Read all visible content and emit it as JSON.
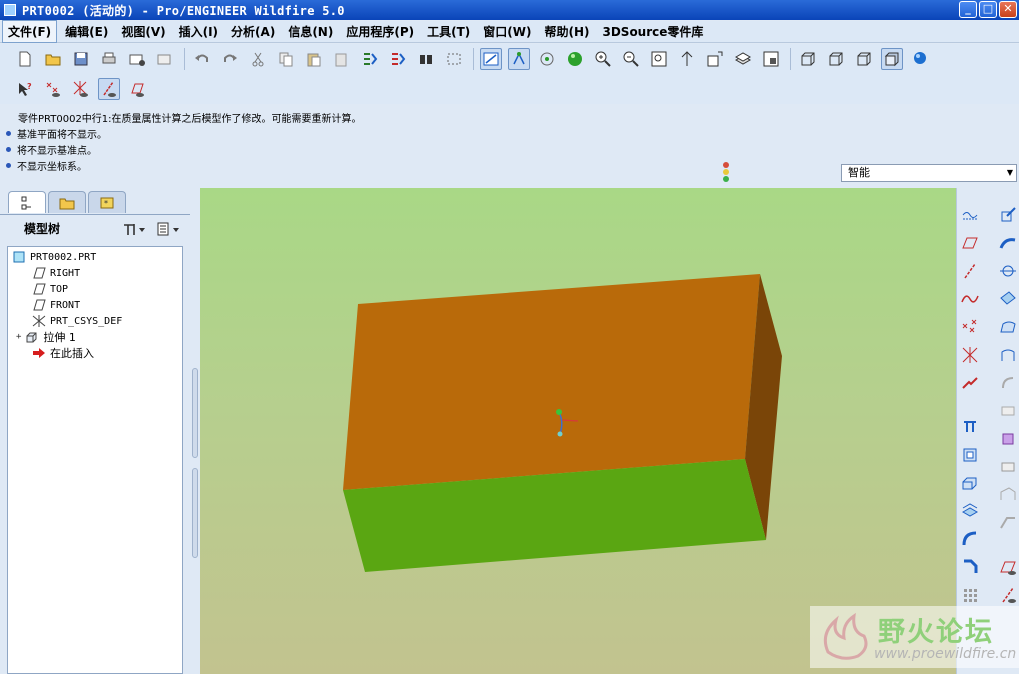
{
  "window": {
    "title": "PRT0002 (活动的) - Pro/ENGINEER Wildfire 5.0",
    "minimize": "_",
    "maximize": "□",
    "close": "✕"
  },
  "menu": [
    {
      "label": "文件(F)",
      "active": true
    },
    {
      "label": "编辑(E)"
    },
    {
      "label": "视图(V)"
    },
    {
      "label": "插入(I)"
    },
    {
      "label": "分析(A)"
    },
    {
      "label": "信息(N)"
    },
    {
      "label": "应用程序(P)"
    },
    {
      "label": "工具(T)"
    },
    {
      "label": "窗口(W)"
    },
    {
      "label": "帮助(H)"
    },
    {
      "label": "3DSource零件库"
    }
  ],
  "messages": {
    "first": "零件PRT0002中行1:在质量属性计算之后模型作了修改。可能需要重新计算。",
    "items": [
      "基准平面将不显示。",
      "将不显示基准点。",
      "不显示坐标系。"
    ]
  },
  "filter": {
    "value": "智能",
    "arrow": "▼"
  },
  "navigator": {
    "title": "模型树",
    "tree": [
      {
        "label": "PRT0002.PRT",
        "icon": "part-icon"
      },
      {
        "label": "RIGHT",
        "icon": "datum-plane-icon"
      },
      {
        "label": "TOP",
        "icon": "datum-plane-icon"
      },
      {
        "label": "FRONT",
        "icon": "datum-plane-icon"
      },
      {
        "label": "PRT_CSYS_DEF",
        "icon": "csys-icon"
      },
      {
        "label": "拉伸 1",
        "icon": "extrude-icon",
        "expander": "+"
      },
      {
        "label": "在此插入",
        "icon": "insert-here-arrow-icon"
      }
    ]
  },
  "watermark": {
    "title": "野火论坛",
    "url": "www.proewildfire.cn"
  },
  "colors": {
    "box_top": "#b96a0a",
    "box_front": "#5aa612",
    "box_side": "#7a4508",
    "viewport_top": "#a9d886",
    "viewport_bottom": "#c2c38f"
  }
}
